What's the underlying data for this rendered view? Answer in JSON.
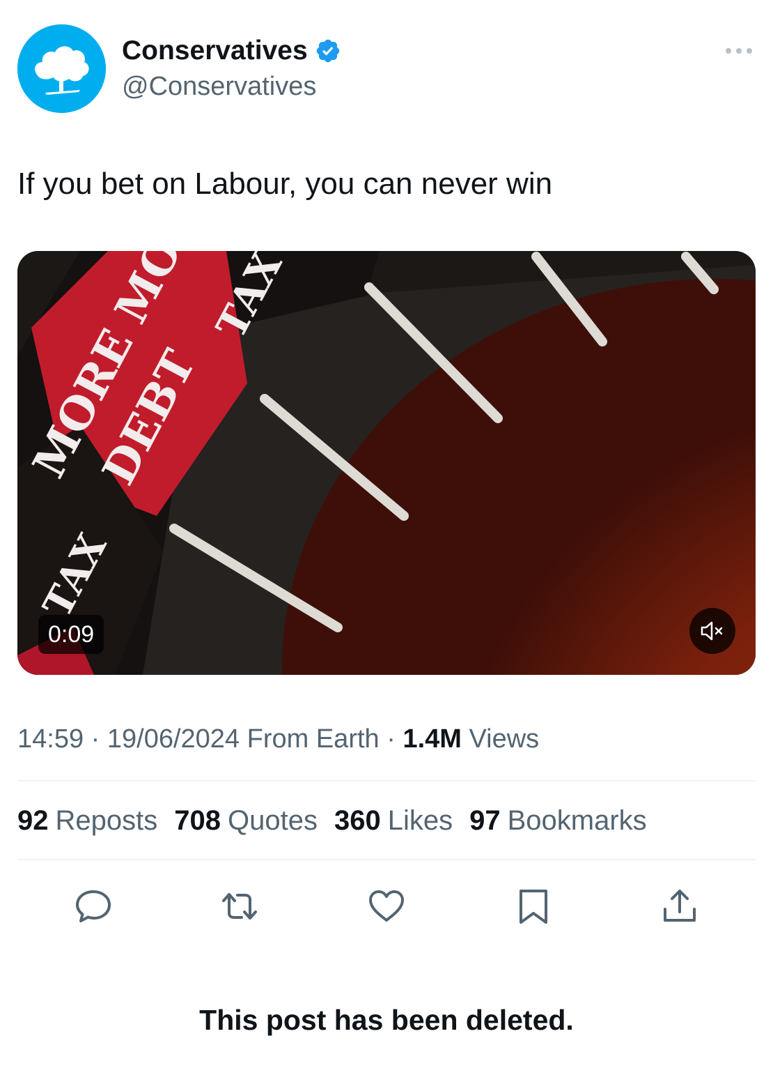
{
  "author": {
    "display_name": "Conservatives",
    "handle": "@Conservatives",
    "verified": true,
    "avatar_color": "#00aeef"
  },
  "tweet": {
    "text": "If you bet on Labour, you can never win"
  },
  "video": {
    "duration": "0:09",
    "muted": true,
    "frame_words": [
      "MORE MO",
      "DEBT",
      "TAX",
      "TAX",
      "RE"
    ]
  },
  "meta": {
    "time": "14:59",
    "separator": "·",
    "date": "19/06/2024",
    "source": "From Earth",
    "views_count": "1.4M",
    "views_label": "Views"
  },
  "stats": {
    "reposts": {
      "count": "92",
      "label": "Reposts"
    },
    "quotes": {
      "count": "708",
      "label": "Quotes"
    },
    "likes": {
      "count": "360",
      "label": "Likes"
    },
    "bookmarks": {
      "count": "97",
      "label": "Bookmarks"
    }
  },
  "actions": [
    "reply-icon",
    "repost-icon",
    "like-icon",
    "bookmark-icon",
    "share-icon"
  ],
  "status_message": "This post has been deleted.",
  "colors": {
    "text_primary": "#0f1419",
    "text_secondary": "#536471",
    "verified_blue": "#1d9bf0",
    "divider": "#eff3f4"
  }
}
